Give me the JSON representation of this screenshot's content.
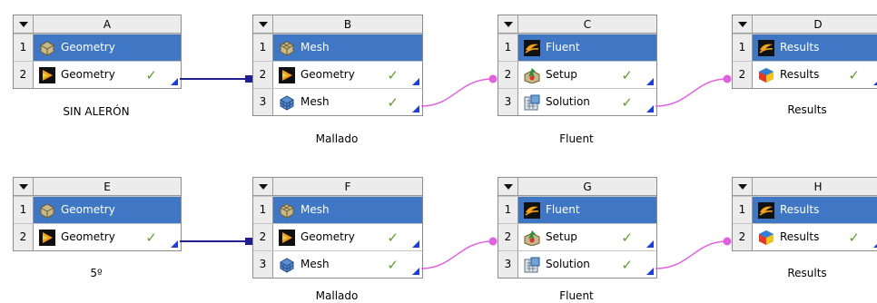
{
  "systems": [
    {
      "letter": "A",
      "caption": "SIN ALERÓN",
      "rows": [
        {
          "num": "1",
          "label": "Geometry",
          "icon": "geometry-cube-icon",
          "check": false
        },
        {
          "num": "2",
          "label": "Geometry",
          "icon": "designmodeler-icon",
          "check": true
        }
      ]
    },
    {
      "letter": "B",
      "caption": "Mallado",
      "rows": [
        {
          "num": "1",
          "label": "Mesh",
          "icon": "mesh-cube-icon",
          "check": false
        },
        {
          "num": "2",
          "label": "Geometry",
          "icon": "designmodeler-icon",
          "check": true
        },
        {
          "num": "3",
          "label": "Mesh",
          "icon": "mesh-icon",
          "check": true
        }
      ]
    },
    {
      "letter": "C",
      "caption": "Fluent",
      "rows": [
        {
          "num": "1",
          "label": "Fluent",
          "icon": "fluent-icon",
          "check": false
        },
        {
          "num": "2",
          "label": "Setup",
          "icon": "setup-icon",
          "check": true
        },
        {
          "num": "3",
          "label": "Solution",
          "icon": "solution-icon",
          "check": true
        }
      ]
    },
    {
      "letter": "D",
      "caption": "Results",
      "rows": [
        {
          "num": "1",
          "label": "Results",
          "icon": "fluent-icon",
          "check": false
        },
        {
          "num": "2",
          "label": "Results",
          "icon": "results-icon",
          "check": true
        }
      ]
    },
    {
      "letter": "E",
      "caption": "5º",
      "rows": [
        {
          "num": "1",
          "label": "Geometry",
          "icon": "geometry-cube-icon",
          "check": false
        },
        {
          "num": "2",
          "label": "Geometry",
          "icon": "designmodeler-icon",
          "check": true
        }
      ]
    },
    {
      "letter": "F",
      "caption": "Mallado",
      "rows": [
        {
          "num": "1",
          "label": "Mesh",
          "icon": "mesh-cube-icon",
          "check": false
        },
        {
          "num": "2",
          "label": "Geometry",
          "icon": "designmodeler-icon",
          "check": true
        },
        {
          "num": "3",
          "label": "Mesh",
          "icon": "mesh-icon",
          "check": true
        }
      ]
    },
    {
      "letter": "G",
      "caption": "Fluent",
      "rows": [
        {
          "num": "1",
          "label": "Fluent",
          "icon": "fluent-icon",
          "check": false
        },
        {
          "num": "2",
          "label": "Setup",
          "icon": "setup-icon",
          "check": true
        },
        {
          "num": "3",
          "label": "Solution",
          "icon": "solution-icon",
          "check": true
        }
      ]
    },
    {
      "letter": "H",
      "caption": "Results",
      "rows": [
        {
          "num": "1",
          "label": "Results",
          "icon": "fluent-icon",
          "check": false
        },
        {
          "num": "2",
          "label": "Results",
          "icon": "results-icon",
          "check": true
        }
      ]
    }
  ],
  "check_mark": "✓",
  "colors": {
    "selected_row": "#3f77c4",
    "check": "#5c9e2e",
    "geometry_link": "#1f1f8f",
    "data_link": "#e060e0",
    "corner_marker": "#1d3fd6"
  }
}
